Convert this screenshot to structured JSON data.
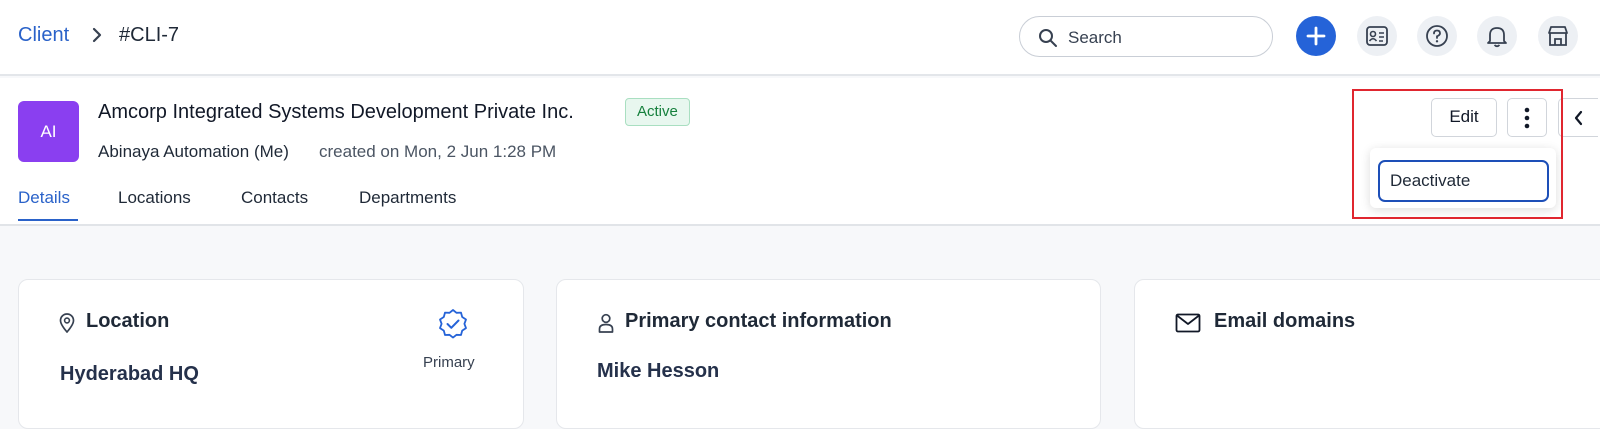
{
  "breadcrumb": {
    "parent": "Client",
    "separator": ">",
    "current": "#CLI-7"
  },
  "search": {
    "placeholder": "Search"
  },
  "client": {
    "initials": "AI",
    "name": "Amcorp Integrated Systems Development Private Inc.",
    "status": "Active",
    "owner": "Abinaya Automation (Me)",
    "created": "created on Mon, 2 Jun 1:28 PM"
  },
  "tabs": [
    {
      "label": "Details",
      "active": true
    },
    {
      "label": "Locations",
      "active": false
    },
    {
      "label": "Contacts",
      "active": false
    },
    {
      "label": "Departments",
      "active": false
    }
  ],
  "actions": {
    "edit": "Edit"
  },
  "dropdown": {
    "items": [
      "Deactivate"
    ]
  },
  "cards": {
    "location": {
      "title": "Location",
      "badge": "Primary",
      "value": "Hyderabad HQ"
    },
    "contact": {
      "title": "Primary contact information",
      "value": "Mike Hesson"
    },
    "email": {
      "title": "Email domains"
    }
  },
  "colors": {
    "accent": "#2563d8",
    "avatar": "#8a3ff0",
    "status_bg": "#e8f7ef",
    "status_text": "#16803d",
    "highlight": "#e0262f"
  }
}
